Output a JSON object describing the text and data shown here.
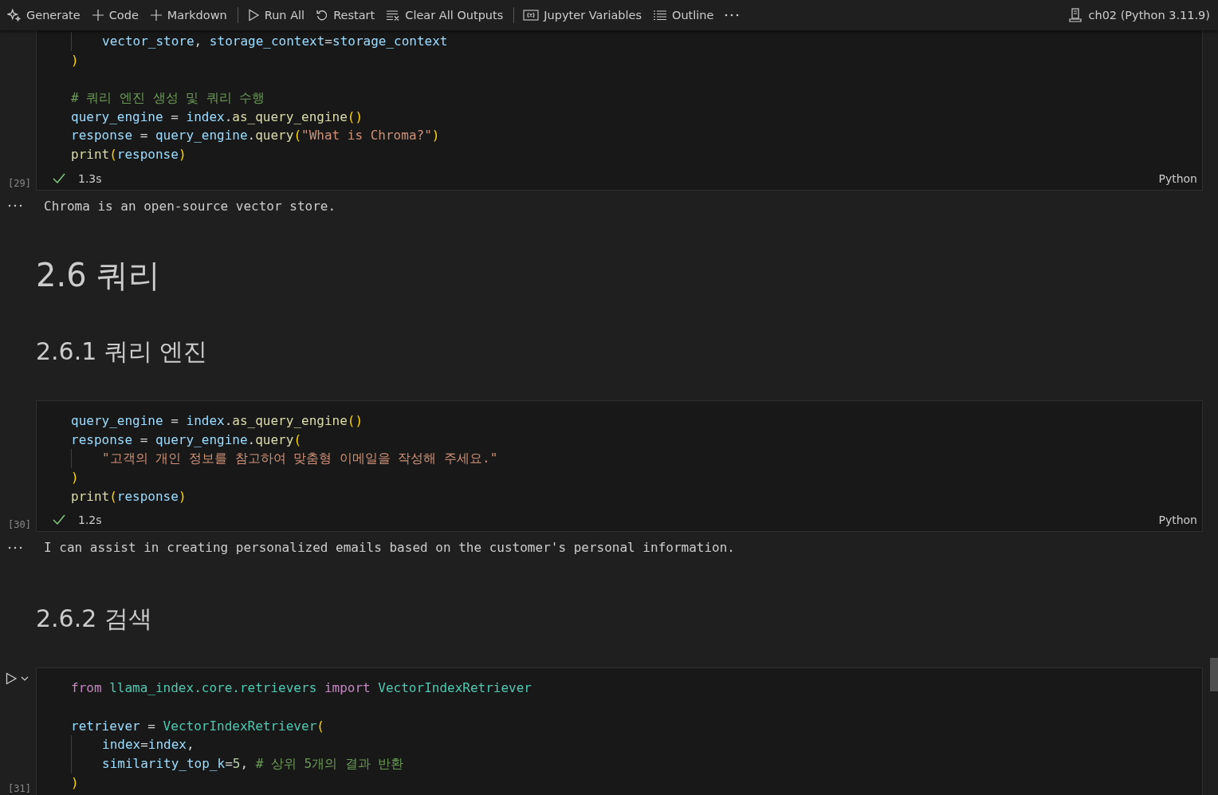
{
  "toolbar": {
    "items": [
      {
        "kind": "generate",
        "label": "Generate"
      },
      {
        "kind": "add",
        "label": "Code"
      },
      {
        "kind": "add",
        "label": "Markdown"
      },
      {
        "kind": "divider"
      },
      {
        "kind": "run",
        "label": "Run All"
      },
      {
        "kind": "restart",
        "label": "Restart"
      },
      {
        "kind": "clear",
        "label": "Clear All Outputs"
      },
      {
        "kind": "divider"
      },
      {
        "kind": "variables",
        "label": "Jupyter Variables"
      },
      {
        "kind": "outline",
        "label": "Outline"
      },
      {
        "kind": "more"
      }
    ],
    "kernel": "ch02 (Python 3.11.9)"
  },
  "cells": [
    {
      "kind": "code",
      "focused": false,
      "count": "[29]",
      "status": {
        "success": true,
        "time": "1.3s"
      },
      "language": "Python",
      "lines": [
        {
          "kind": "code",
          "indented": true,
          "tokens": [
            {
              "kind": "var",
              "text": "vector_store"
            },
            {
              "kind": "op",
              "text": ", "
            },
            {
              "kind": "var",
              "text": "storage_context"
            },
            {
              "kind": "op",
              "text": "="
            },
            {
              "kind": "var",
              "text": "storage_context"
            }
          ]
        },
        {
          "kind": "code",
          "indented": false,
          "tokens": [
            {
              "kind": "paren",
              "text": ")"
            }
          ]
        },
        {
          "kind": "blank"
        },
        {
          "kind": "code",
          "indented": false,
          "tokens": [
            {
              "kind": "cmt",
              "text": "# 쿼리 엔진 생성 및 쿼리 수행"
            }
          ]
        },
        {
          "kind": "code",
          "indented": false,
          "tokens": [
            {
              "kind": "var",
              "text": "query_engine"
            },
            {
              "kind": "op",
              "text": " = "
            },
            {
              "kind": "var",
              "text": "index"
            },
            {
              "kind": "op",
              "text": "."
            },
            {
              "kind": "fn",
              "text": "as_query_engine"
            },
            {
              "kind": "paren",
              "text": "()"
            }
          ]
        },
        {
          "kind": "code",
          "indented": false,
          "tokens": [
            {
              "kind": "var",
              "text": "response"
            },
            {
              "kind": "op",
              "text": " = "
            },
            {
              "kind": "var",
              "text": "query_engine"
            },
            {
              "kind": "op",
              "text": "."
            },
            {
              "kind": "fn",
              "text": "query"
            },
            {
              "kind": "paren",
              "text": "("
            },
            {
              "kind": "str",
              "text": "\"What is Chroma?\""
            },
            {
              "kind": "paren",
              "text": ")"
            }
          ]
        },
        {
          "kind": "code",
          "indented": false,
          "tokens": [
            {
              "kind": "fn",
              "text": "print"
            },
            {
              "kind": "paren",
              "text": "("
            },
            {
              "kind": "var",
              "text": "response"
            },
            {
              "kind": "paren",
              "text": ")"
            }
          ]
        }
      ]
    },
    {
      "kind": "output",
      "text": "Chroma is an open-source vector store."
    },
    {
      "kind": "h1",
      "text": "2.6 쿼리"
    },
    {
      "kind": "h2",
      "text": "2.6.1 쿼리 엔진"
    },
    {
      "kind": "code",
      "focused": false,
      "count": "[30]",
      "status": {
        "success": true,
        "time": "1.2s"
      },
      "language": "Python",
      "lines": [
        {
          "kind": "code",
          "indented": false,
          "tokens": [
            {
              "kind": "var",
              "text": "query_engine"
            },
            {
              "kind": "op",
              "text": " = "
            },
            {
              "kind": "var",
              "text": "index"
            },
            {
              "kind": "op",
              "text": "."
            },
            {
              "kind": "fn",
              "text": "as_query_engine"
            },
            {
              "kind": "paren",
              "text": "()"
            }
          ]
        },
        {
          "kind": "code",
          "indented": false,
          "tokens": [
            {
              "kind": "var",
              "text": "response"
            },
            {
              "kind": "op",
              "text": " = "
            },
            {
              "kind": "var",
              "text": "query_engine"
            },
            {
              "kind": "op",
              "text": "."
            },
            {
              "kind": "fn",
              "text": "query"
            },
            {
              "kind": "paren",
              "text": "("
            }
          ]
        },
        {
          "kind": "code",
          "indented": true,
          "tokens": [
            {
              "kind": "str",
              "text": "\"고객의 개인 정보를 참고하여 맞춤형 이메일을 작성해 주세요.\""
            }
          ]
        },
        {
          "kind": "code",
          "indented": false,
          "tokens": [
            {
              "kind": "paren",
              "text": ")"
            }
          ]
        },
        {
          "kind": "code",
          "indented": false,
          "tokens": [
            {
              "kind": "fn",
              "text": "print"
            },
            {
              "kind": "paren",
              "text": "("
            },
            {
              "kind": "var",
              "text": "response"
            },
            {
              "kind": "paren",
              "text": ")"
            }
          ]
        }
      ]
    },
    {
      "kind": "output",
      "text": "I can assist in creating personalized emails based on the customer's personal information."
    },
    {
      "kind": "h2",
      "text": "2.6.2 검색"
    },
    {
      "kind": "code",
      "focused": true,
      "count": "[31]",
      "lines": [
        {
          "kind": "code",
          "indented": false,
          "tokens": [
            {
              "kind": "kw",
              "text": "from "
            },
            {
              "kind": "cls",
              "text": "llama_index.core.retrievers "
            },
            {
              "kind": "kw",
              "text": "import "
            },
            {
              "kind": "cls",
              "text": "VectorIndexRetriever"
            }
          ]
        },
        {
          "kind": "blank"
        },
        {
          "kind": "code",
          "indented": false,
          "tokens": [
            {
              "kind": "var",
              "text": "retriever"
            },
            {
              "kind": "op",
              "text": " = "
            },
            {
              "kind": "cls",
              "text": "VectorIndexRetriever"
            },
            {
              "kind": "paren",
              "text": "("
            }
          ]
        },
        {
          "kind": "code",
          "indented": true,
          "tokens": [
            {
              "kind": "var",
              "text": "index"
            },
            {
              "kind": "op",
              "text": "="
            },
            {
              "kind": "var",
              "text": "index"
            },
            {
              "kind": "op",
              "text": ","
            }
          ]
        },
        {
          "kind": "code",
          "indented": true,
          "tokens": [
            {
              "kind": "var",
              "text": "similarity_top_k"
            },
            {
              "kind": "op",
              "text": "="
            },
            {
              "kind": "num",
              "text": "5"
            },
            {
              "kind": "op",
              "text": ", "
            },
            {
              "kind": "cmt",
              "text": "# 상위 5개의 결과 반환"
            }
          ]
        },
        {
          "kind": "code",
          "indented": false,
          "tokens": [
            {
              "kind": "paren",
              "text": ")"
            }
          ]
        }
      ]
    }
  ]
}
